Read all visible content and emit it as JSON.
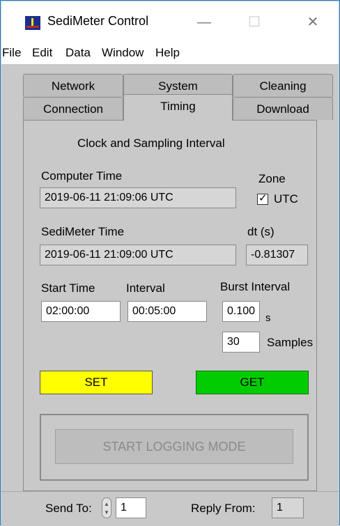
{
  "window": {
    "title": "SediMeter Control",
    "minimize": "—",
    "maximize": "☐",
    "close": "✕"
  },
  "menu": [
    "File",
    "Edit",
    "Data",
    "Window",
    "Help"
  ],
  "tabs": {
    "row1": [
      "Network",
      "System",
      "Cleaning"
    ],
    "row2": [
      "Connection",
      "Timing",
      "Download"
    ]
  },
  "section_title": "Clock and Sampling Interval",
  "computer_time": {
    "label": "Computer Time",
    "value": "2019-06-11 21:09:06 UTC"
  },
  "zone": {
    "label": "Zone",
    "utc_label": "UTC",
    "utc_checked": true
  },
  "sedimeter_time": {
    "label": "SediMeter Time",
    "value": "2019-06-11 21:09:00 UTC"
  },
  "dt": {
    "label": "dt (s)",
    "value": "-0.81307"
  },
  "start_time": {
    "label": "Start Time",
    "value": "02:00:00"
  },
  "interval": {
    "label": "Interval",
    "value": "00:05:00"
  },
  "burst": {
    "label": "Burst Interval",
    "value": "0.100",
    "unit": "s",
    "samples": "30",
    "samples_label": "Samples"
  },
  "buttons": {
    "set": "SET",
    "get": "GET",
    "start_logging": "START LOGGING MODE"
  },
  "status": {
    "send_to_label": "Send To:",
    "send_to_value": "1",
    "reply_from_label": "Reply From:",
    "reply_from_value": "1"
  }
}
